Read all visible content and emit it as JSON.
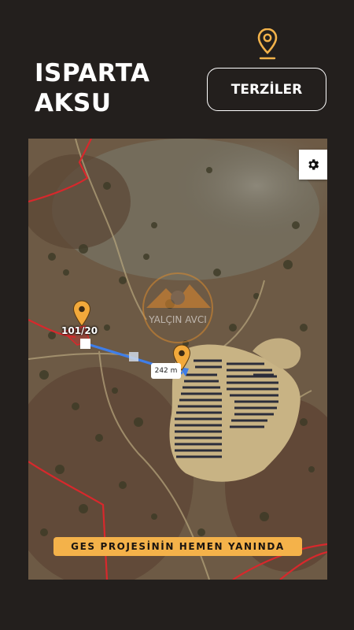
{
  "header": {
    "title_line1": "ISPARTA",
    "title_line2": "AKSU",
    "location_icon": "map-pin-icon",
    "button_label": "TERZİLER"
  },
  "map": {
    "parcel_label": "101/20",
    "distance_label": "242 m",
    "caption": "GES PROJESİNİN HEMEN YANINDA",
    "settings_icon": "gear-icon",
    "watermark_text": "YALÇIN AVCI",
    "colors": {
      "pin": "#f2a93b",
      "measure_line": "#3f7ee8",
      "boundary": "#d8282c",
      "caption_bg": "#f4b24a"
    }
  }
}
